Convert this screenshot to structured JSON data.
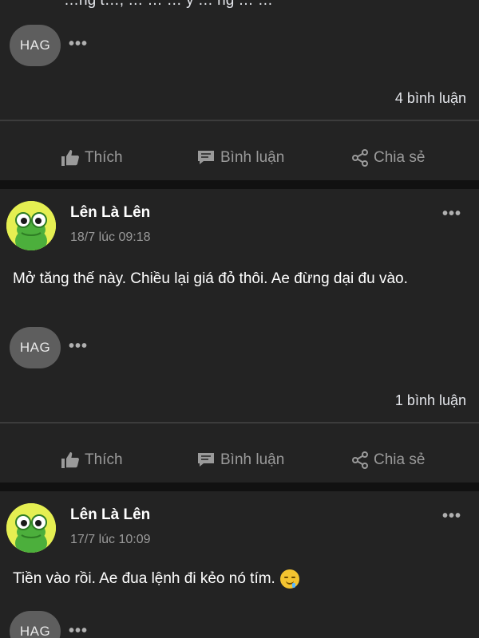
{
  "reactions": {
    "like_label": "Thích",
    "comment_label": "Bình luận",
    "share_label": "Chia sẻ"
  },
  "posts": [
    {
      "partial_text": "…ng t…, … … … y … ng … …",
      "tag": "HAG",
      "tag_more": "•••",
      "comment_count": "4 bình luận"
    },
    {
      "author": "Lên Là Lên",
      "time": "18/7 lúc 09:18",
      "more": "•••",
      "text": "Mở tăng thế này. Chiều lại giá đỏ thôi. Ae đừng dại đu vào.",
      "tag": "HAG",
      "tag_more": "•••",
      "comment_count": "1 bình luận"
    },
    {
      "author": "Lên Là Lên",
      "time": "17/7 lúc 10:09",
      "more": "•••",
      "text": "Tiền vào rồi. Ae đua lệnh đi kẻo nó tím.",
      "tag": "HAG",
      "tag_more": "•••"
    }
  ],
  "colors": {
    "background": "#111111",
    "card": "#232323",
    "tag_pill": "#5e5e5e",
    "muted_text": "#9a9a9a",
    "avatar_bg": "#e5ef52",
    "frog_green": "#4caf3c"
  }
}
